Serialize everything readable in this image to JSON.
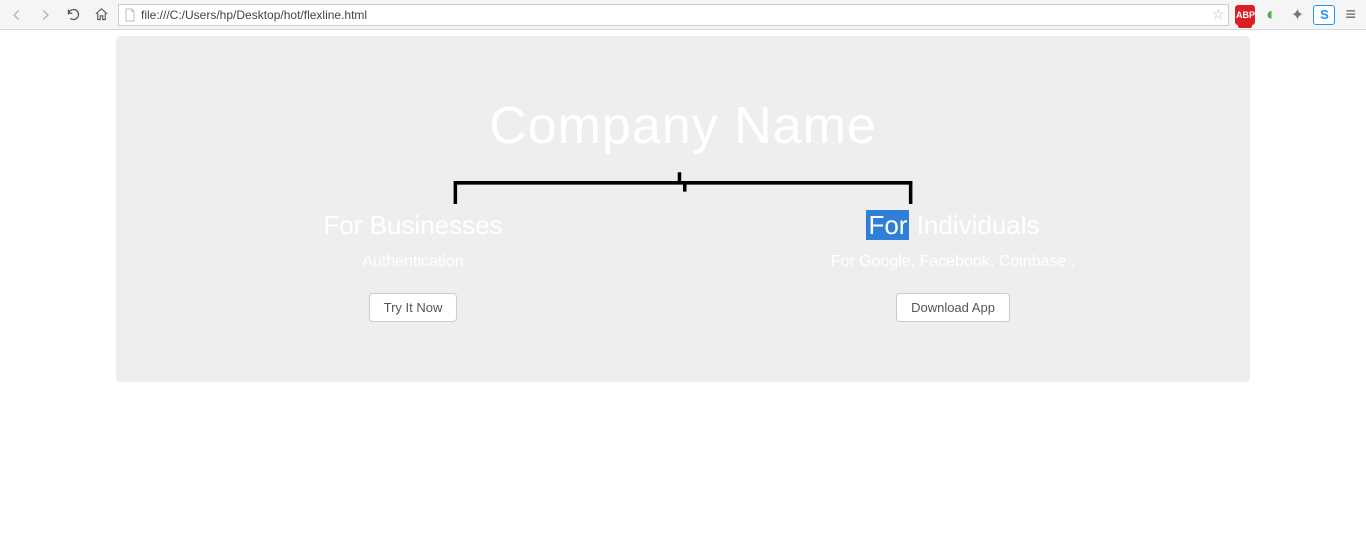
{
  "browser": {
    "url": "file:///C:/Users/hp/Desktop/hot/flexline.html"
  },
  "page": {
    "title": "Company Name",
    "left": {
      "heading": "For Businesses",
      "sub": "Authentication",
      "button": "Try It Now"
    },
    "right": {
      "heading_prefix": "For",
      "heading_rest": " Individuals",
      "sub": "For Google, Facebook, Coinbase .",
      "button": "Download App"
    }
  }
}
